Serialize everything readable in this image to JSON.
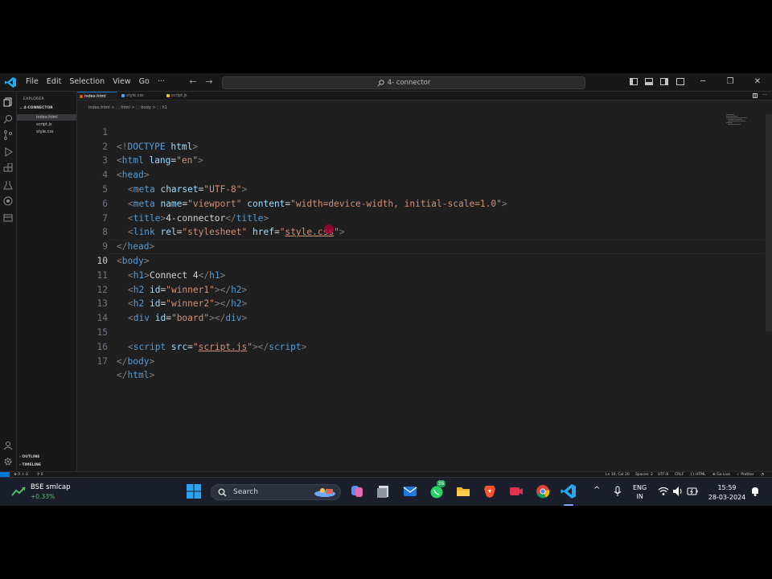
{
  "window": {
    "search": "4- connector"
  },
  "menu": [
    "File",
    "Edit",
    "Selection",
    "View",
    "Go",
    "···"
  ],
  "explorer": {
    "header": "EXPLORER",
    "folder": "4-CONNECTOR",
    "files": [
      "index.html",
      "script.js",
      "style.css"
    ],
    "outline": "OUTLINE",
    "timeline": "TIMELINE"
  },
  "tabs": [
    {
      "label": "index.html",
      "color": "#e44d26"
    },
    {
      "label": "style.css",
      "color": "#42a5f5"
    },
    {
      "label": "script.js",
      "color": "#f1c40f"
    }
  ],
  "breadcrumb": "index.html > ⬚ html > ⬚ body > ⬚ h1",
  "editor": {
    "line_numbers": [
      "1",
      "2",
      "3",
      "4",
      "5",
      "6",
      "7",
      "8",
      "9",
      "10",
      "11",
      "12",
      "13",
      "14",
      "15",
      "16",
      "17"
    ],
    "current_line": "10",
    "l1": [
      "<!",
      "DOCTYPE",
      " ",
      "html",
      ">"
    ],
    "l2": [
      "<",
      "html",
      " ",
      "lang",
      "=",
      "\"en\"",
      ">"
    ],
    "l3": [
      "<",
      "head",
      ">"
    ],
    "l4": [
      "<",
      "meta",
      " ",
      "charset",
      "=",
      "\"UTF-8\"",
      ">"
    ],
    "l5": [
      "<",
      "meta",
      " ",
      "name",
      "=",
      "\"viewport\"",
      " ",
      "content",
      "=",
      "\"width=device-width, initial-scale=1.0\"",
      ">"
    ],
    "l6": [
      "<",
      "title",
      ">",
      "4-connector",
      "</",
      "title",
      ">"
    ],
    "l7": [
      "<",
      "link",
      " ",
      "rel",
      "=",
      "\"stylesheet\"",
      " ",
      "href",
      "=",
      "\"",
      "style.css",
      "\"",
      ">"
    ],
    "l8": [
      "</",
      "head",
      ">"
    ],
    "l9": [
      "<",
      "body",
      ">"
    ],
    "l10": [
      "<",
      "h1",
      ">",
      "Connect 4",
      "</",
      "h1",
      ">"
    ],
    "l11": [
      "<",
      "h2",
      " ",
      "id",
      "=",
      "\"winner1\"",
      "></",
      "h2",
      ">"
    ],
    "l12": [
      "<",
      "h2",
      " ",
      "id",
      "=",
      "\"winner2\"",
      "></",
      "h2",
      ">"
    ],
    "l13": [
      "<",
      "div",
      " ",
      "id",
      "=",
      "\"board\"",
      "></",
      "div",
      ">"
    ],
    "l15": [
      "<",
      "script",
      " ",
      "src",
      "=",
      "\"",
      "script.js",
      "\"",
      "></",
      "script",
      ">"
    ],
    "l16": [
      "</",
      "body",
      ">"
    ],
    "l17": [
      "</",
      "html",
      ">"
    ]
  },
  "status": {
    "problems": "⊗ 0 ⚠ 0",
    "ports": "⚲ 0",
    "position": "Ln 10, Col 20",
    "spaces": "Spaces: 2",
    "encoding": "UTF-8",
    "eol": "CRLF",
    "language": "{} HTML",
    "golive": "⊕ Go Live",
    "prettier": "✓ Prettier"
  },
  "taskbar": {
    "widget_title": "BSE smlcap",
    "widget_value": "+0.33%",
    "search_label": "Search",
    "whatsapp_badge": "36",
    "lang1": "ENG",
    "lang2": "IN",
    "time": "15:59",
    "date": "28-03-2024"
  }
}
